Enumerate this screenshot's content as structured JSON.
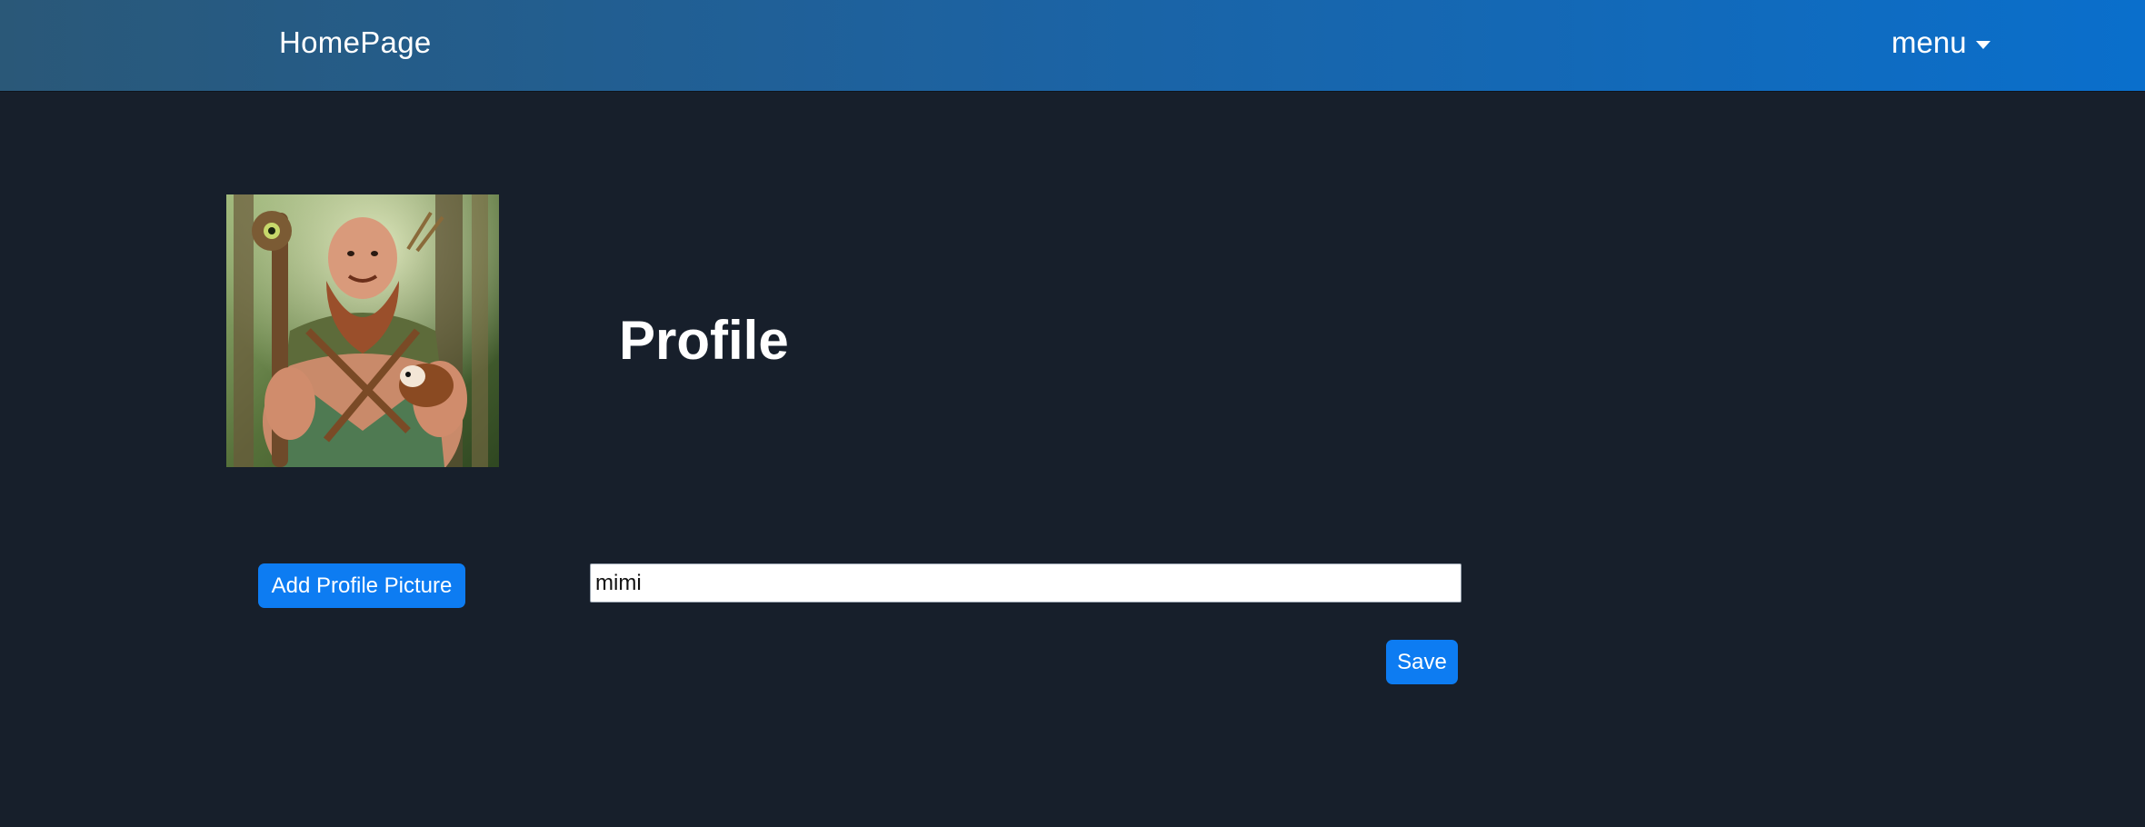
{
  "navbar": {
    "brand": "HomePage",
    "menu_label": "menu"
  },
  "profile": {
    "title": "Profile",
    "avatar_alt": "profile picture"
  },
  "actions": {
    "add_picture_label": "Add Profile Picture",
    "save_label": "Save"
  },
  "form": {
    "name_value": "mimi",
    "name_placeholder": ""
  },
  "colors": {
    "page_background": "#171f2b",
    "navbar_start": "#2a5878",
    "navbar_end": "#0a6fcc",
    "button_primary": "#0d7cf2",
    "text_light": "#ffffff"
  },
  "icons": {
    "menu_caret": "caret-down-icon"
  }
}
